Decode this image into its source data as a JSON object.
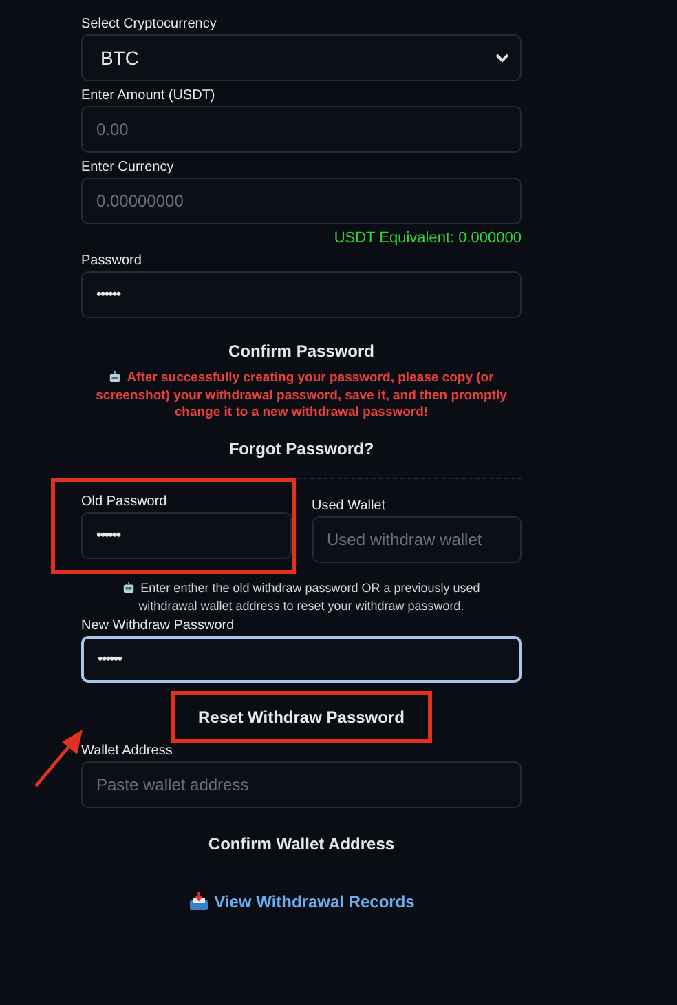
{
  "fields": [
    {
      "kind": "select",
      "label": "Select Cryptocurrency",
      "value": "BTC"
    },
    {
      "kind": "input",
      "label": "Enter Amount (USDT)",
      "placeholder": "0.00"
    },
    {
      "kind": "input",
      "label": "Enter Currency",
      "placeholder": "0.00000000",
      "note": "USDT Equivalent: 0.000000"
    },
    {
      "kind": "password",
      "label": "Password",
      "value": "••••••"
    }
  ],
  "confirm_button": "Confirm Password",
  "warning": "After successfully creating your password, please copy (or screenshot) your withdrawal password, save it, and then promptly change it to a new withdrawal password!",
  "forgot_title": "Forgot Password?",
  "reset": {
    "old_password": {
      "label": "Old Password",
      "value": "••••••",
      "highlighted": true
    },
    "used_wallet": {
      "label": "Used Wallet",
      "placeholder": "Used withdraw wallet",
      "highlighted": false
    },
    "hint": "Enter enther the old withdraw password OR a previously used withdrawal wallet address to reset your withdraw password.",
    "new_password": {
      "label": "New Withdraw Password",
      "value": "••••••",
      "focused": true
    },
    "button": {
      "label": "Reset Withdraw Password",
      "highlighted": true
    }
  },
  "wallet": {
    "label": "Wallet Address",
    "placeholder": "Paste wallet address",
    "button": "Confirm Wallet Address"
  },
  "records_link": "View Withdrawal Records"
}
